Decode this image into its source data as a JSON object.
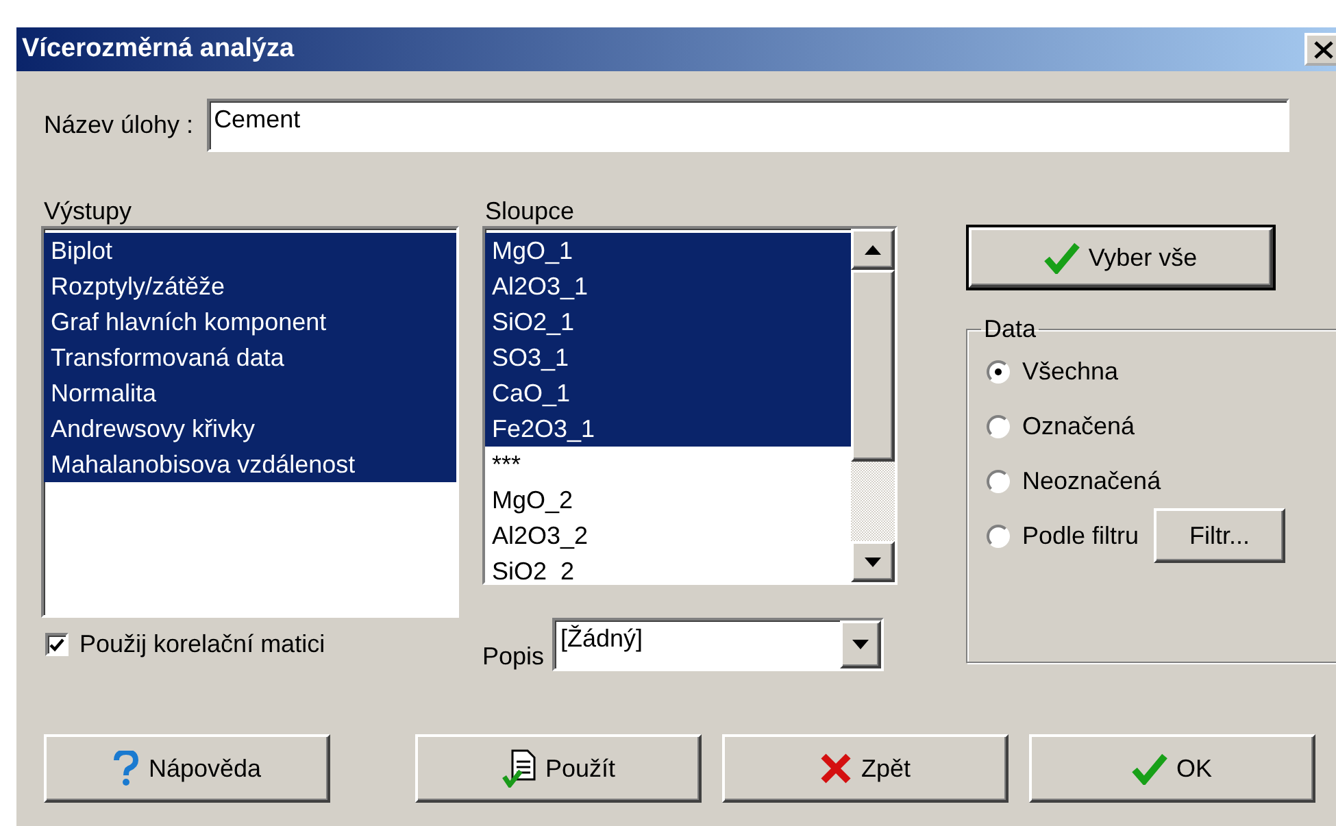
{
  "window": {
    "title": "Vícerozměrná analýza"
  },
  "task_name": {
    "label": "Název úlohy :",
    "value": "Cement"
  },
  "outputs": {
    "label": "Výstupy",
    "items": [
      {
        "label": "Biplot",
        "selected": true
      },
      {
        "label": "Rozptyly/zátěže",
        "selected": true
      },
      {
        "label": "Graf hlavních komponent",
        "selected": true
      },
      {
        "label": "Transformovaná data",
        "selected": true
      },
      {
        "label": "Normalita",
        "selected": true
      },
      {
        "label": "Andrewsovy křivky",
        "selected": true
      },
      {
        "label": "Mahalanobisova vzdálenost",
        "selected": true
      }
    ]
  },
  "columns": {
    "label": "Sloupce",
    "items": [
      {
        "label": "MgO_1",
        "selected": true
      },
      {
        "label": "Al2O3_1",
        "selected": true
      },
      {
        "label": "SiO2_1",
        "selected": true
      },
      {
        "label": "SO3_1",
        "selected": true
      },
      {
        "label": "CaO_1",
        "selected": true
      },
      {
        "label": "Fe2O3_1",
        "selected": true
      },
      {
        "label": "***",
        "selected": false
      },
      {
        "label": "MgO_2",
        "selected": false
      },
      {
        "label": "Al2O3_2",
        "selected": false
      },
      {
        "label": "SiO2_2",
        "selected": false
      }
    ]
  },
  "correlation_matrix": {
    "label": "Použij korelační matici",
    "checked": true
  },
  "caption": {
    "label": "Popis",
    "value": "[Žádný]"
  },
  "select_all_button": {
    "label": "Vyber vše"
  },
  "data_group": {
    "title": "Data",
    "options": [
      {
        "label": "Všechna",
        "selected": true
      },
      {
        "label": "Označená",
        "selected": false
      },
      {
        "label": "Neoznačená",
        "selected": false
      },
      {
        "label": "Podle filtru",
        "selected": false
      }
    ],
    "filter_button": {
      "label": "Filtr..."
    }
  },
  "buttons": [
    {
      "kind": "help",
      "label": "Nápověda"
    },
    {
      "kind": "apply",
      "label": "Použít"
    },
    {
      "kind": "back",
      "label": "Zpět"
    },
    {
      "kind": "ok",
      "label": "OK"
    }
  ]
}
